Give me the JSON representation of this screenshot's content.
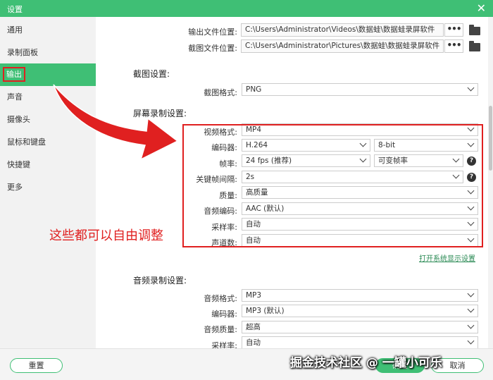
{
  "window": {
    "title": "设置",
    "close_icon": "close-icon"
  },
  "sidebar": {
    "items": [
      {
        "label": "通用"
      },
      {
        "label": "录制面板"
      },
      {
        "label": "输出",
        "active": true
      },
      {
        "label": "声音"
      },
      {
        "label": "摄像头"
      },
      {
        "label": "鼠标和键盘"
      },
      {
        "label": "快捷键"
      },
      {
        "label": "更多"
      }
    ]
  },
  "output": {
    "video_path_label": "输出文件位置:",
    "video_path": "C:\\Users\\Administrator\\Videos\\数据蛙\\数据蛙录屏软件",
    "shot_path_label": "截图文件位置:",
    "shot_path": "C:\\Users\\Administrator\\Pictures\\数据蛙\\数据蛙录屏软件",
    "browse_label": "•••"
  },
  "screenshot": {
    "title": "截图设置:",
    "format_label": "截图格式:",
    "format": "PNG"
  },
  "screen": {
    "title": "屏幕录制设置:",
    "video_format_label": "视频格式:",
    "video_format": "MP4",
    "encoder_label": "编码器:",
    "encoder": "H.264",
    "bit_depth": "8-bit",
    "framerate_label": "帧率:",
    "framerate": "24 fps (推荐)",
    "framerate_mode": "可变帧率",
    "keyframe_label": "关键帧间隔:",
    "keyframe": "2s",
    "quality_label": "质量:",
    "quality": "高质量",
    "audio_codec_label": "音频编码:",
    "audio_codec": "AAC (默认)",
    "samplerate_label": "采样率:",
    "samplerate": "自动",
    "channels_label": "声道数:",
    "channels": "自动",
    "display_link": "打开系统显示设置",
    "help_glyph": "?"
  },
  "audio": {
    "title": "音频录制设置:",
    "format_label": "音频格式:",
    "format": "MP3",
    "encoder_label": "编码器:",
    "encoder": "MP3 (默认)",
    "quality_label": "音频质量:",
    "quality": "超高",
    "samplerate_label": "采样率:",
    "samplerate": "自动"
  },
  "annotation": "这些都可以自由调整",
  "footer": {
    "reset": "重置",
    "ok": "确定",
    "cancel": "取消"
  },
  "watermark": "掘金技术社区 @ 一罐小可乐",
  "colors": {
    "accent": "#3fbf75",
    "highlight": "#e02020"
  }
}
